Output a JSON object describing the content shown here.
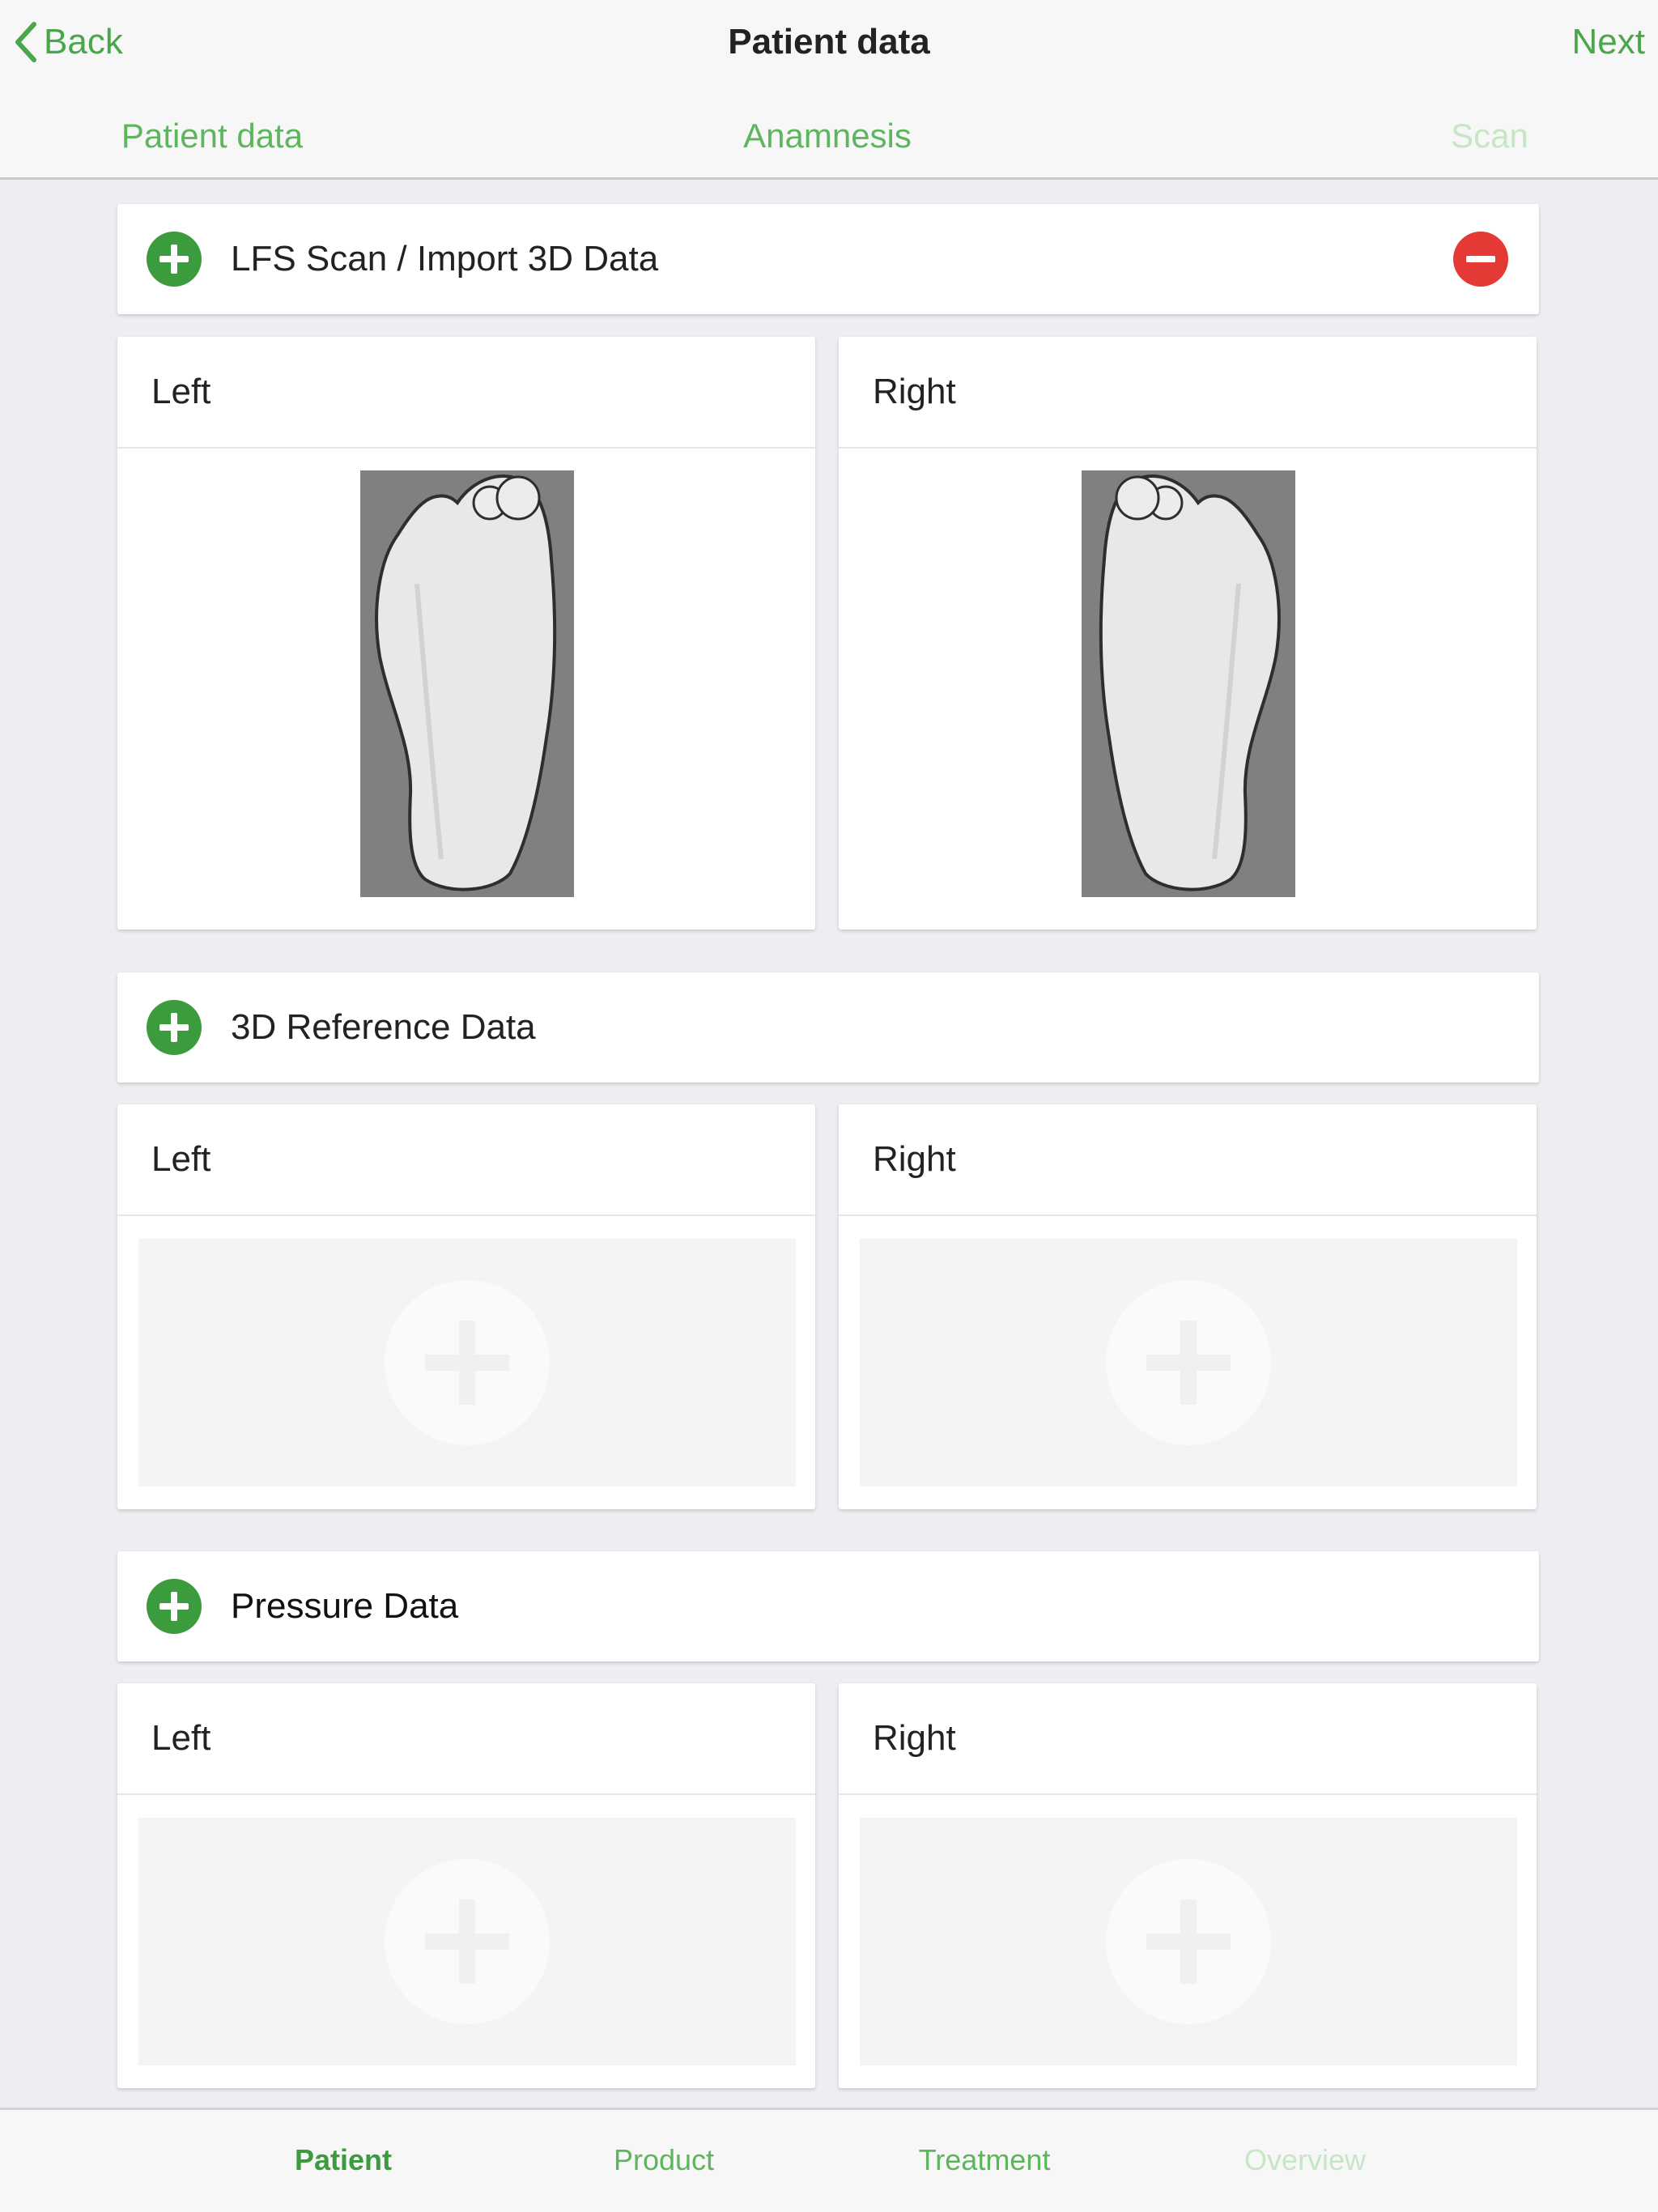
{
  "nav": {
    "back_label": "Back",
    "title": "Patient data",
    "next_label": "Next"
  },
  "steps": [
    {
      "label": "Patient data",
      "state": "enabled"
    },
    {
      "label": "Anamnesis",
      "state": "enabled"
    },
    {
      "label": "Scan",
      "state": "disabled"
    }
  ],
  "sections": {
    "lfs": {
      "title": "LFS Scan / Import 3D Data",
      "left_label": "Left",
      "right_label": "Right"
    },
    "reference": {
      "title": "3D Reference Data",
      "left_label": "Left",
      "right_label": "Right"
    },
    "pressure": {
      "title": "Pressure Data",
      "left_label": "Left",
      "right_label": "Right"
    }
  },
  "tabs": [
    {
      "label": "Patient",
      "state": "active"
    },
    {
      "label": "Product",
      "state": "enabled"
    },
    {
      "label": "Treatment",
      "state": "enabled"
    },
    {
      "label": "Overview",
      "state": "disabled"
    }
  ],
  "colors": {
    "accent_green": "#4aa64a",
    "add_button_green": "#3c9b3c",
    "remove_button_red": "#e53935",
    "disabled_text": "#c6e6c6",
    "scan_background": "#808080"
  },
  "icons": {
    "back": "chevron-left-icon",
    "add": "plus-circle-icon",
    "remove": "minus-circle-icon"
  }
}
